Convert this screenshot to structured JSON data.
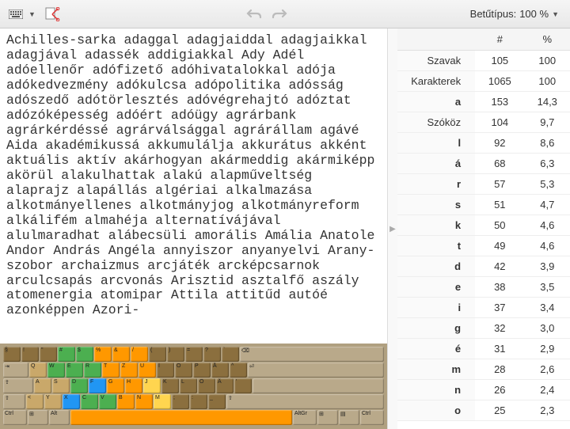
{
  "toolbar": {
    "font_label": "Betűtípus:",
    "zoom": "100 %"
  },
  "text": "Achilles-sarka adaggal adagjaiddal adagjaikkal adagjával adassék addigiakkal Ady Adél adóellenőr adófizető adóhivatalokkal adója adókedvezmény adókulcsa adópolitika adósság adószedő adótörlesztés adóvégrehajtó adóztat adózóképesség adóért adóügy agrárbank agrárkérdéssé agrárválsággal agrárállam agávé Aida akadémikussá akkumulálja akkurátus akként aktuális aktív akárhogyan akármeddig akármiképp akörül alakulhattak alakú alapműveltség alaprajz alapállás algériai alkalmazása alkotmányellenes alkotmányjog alkotmányreform alkálifém almahéja alternatívájával alulmaradhat alábecsüli amorális Amália Anatole Andor András Angéla annyiszor anyanyelvi Arany-szobor archaizmus arcjáték arcképcsarnok arculcsapás arcvonás Arisztid asztalfő aszály atomenergia atomipar Attila attitűd autóé azonképpen Azori-",
  "stats": {
    "head_count": "#",
    "head_pct": "%",
    "label_words": "Szavak",
    "label_chars": "Karakterek",
    "label_space": "Szóköz",
    "rows": [
      {
        "k": "Szavak",
        "c": "105",
        "p": "100"
      },
      {
        "k": "Karakterek",
        "c": "1065",
        "p": "100"
      },
      {
        "k": "a",
        "c": "153",
        "p": "14,3"
      },
      {
        "k": "Szóköz",
        "c": "104",
        "p": "9,7"
      },
      {
        "k": "l",
        "c": "92",
        "p": "8,6"
      },
      {
        "k": "á",
        "c": "68",
        "p": "6,3"
      },
      {
        "k": "r",
        "c": "57",
        "p": "5,3"
      },
      {
        "k": "s",
        "c": "51",
        "p": "4,7"
      },
      {
        "k": "k",
        "c": "50",
        "p": "4,6"
      },
      {
        "k": "t",
        "c": "49",
        "p": "4,6"
      },
      {
        "k": "d",
        "c": "42",
        "p": "3,9"
      },
      {
        "k": "e",
        "c": "38",
        "p": "3,5"
      },
      {
        "k": "i",
        "c": "37",
        "p": "3,4"
      },
      {
        "k": "g",
        "c": "32",
        "p": "3,0"
      },
      {
        "k": "é",
        "c": "31",
        "p": "2,9"
      },
      {
        "k": "m",
        "c": "28",
        "p": "2,6"
      },
      {
        "k": "n",
        "c": "26",
        "p": "2,4"
      },
      {
        "k": "o",
        "c": "25",
        "p": "2,3"
      }
    ]
  }
}
